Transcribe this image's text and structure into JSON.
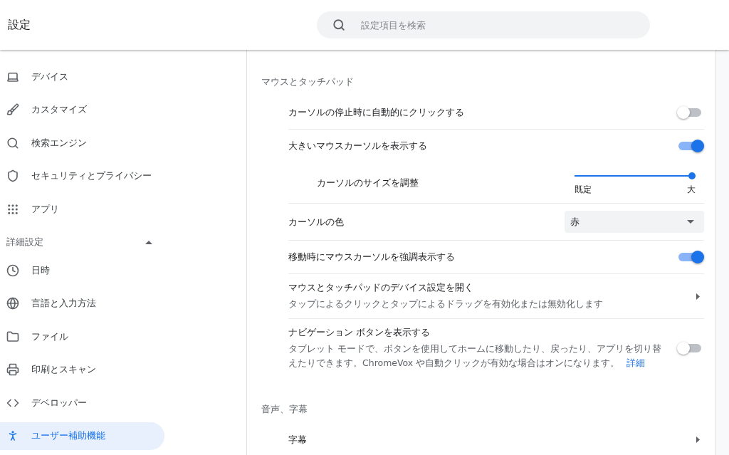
{
  "header": {
    "title": "設定",
    "search": {
      "placeholder": "設定項目を検索"
    }
  },
  "sidebar": {
    "items": [
      {
        "label": "デバイス",
        "selected": false
      },
      {
        "label": "カスタマイズ",
        "selected": false
      },
      {
        "label": "検索エンジン",
        "selected": false
      },
      {
        "label": "セキュリティとプライバシー",
        "selected": false
      },
      {
        "label": "アプリ",
        "selected": false
      }
    ],
    "advanced": {
      "label": "詳細設定",
      "expanded": true,
      "items": [
        {
          "label": "日時",
          "selected": false
        },
        {
          "label": "言語と入力方法",
          "selected": false
        },
        {
          "label": "ファイル",
          "selected": false
        },
        {
          "label": "印刷とスキャン",
          "selected": false
        },
        {
          "label": "デベロッパー",
          "selected": false
        },
        {
          "label": "ユーザー補助機能",
          "selected": true
        }
      ]
    }
  },
  "sections": [
    {
      "title": "マウスとタッチパッド",
      "rows": [
        {
          "kind": "toggle",
          "label": "カーソルの停止時に自動的にクリックする",
          "on": false
        },
        {
          "kind": "toggle",
          "label": "大きいマウスカーソルを表示する",
          "on": true
        },
        {
          "kind": "slider",
          "label": "カーソルのサイズを調整",
          "level": 1,
          "min_label": "既定",
          "max_label": "大"
        },
        {
          "kind": "select",
          "label": "カーソルの色",
          "value": "赤"
        },
        {
          "kind": "toggle",
          "label": "移動時にマウスカーソルを強調表示する",
          "on": true
        },
        {
          "kind": "link",
          "label": "マウスとタッチパッドのデバイス設定を開く",
          "description": "タップによるクリックとタップによるドラッグを有効化または無効化します"
        },
        {
          "kind": "toggle",
          "label": "ナビゲーション ボタンを表示する",
          "description": "タブレット モードで、ボタンを使用してホームに移動したり、戻ったり、アプリを切り替えたりできます。ChromeVox や自動クリックが有効な場合はオンになります。",
          "link": "詳細",
          "on": false
        }
      ]
    },
    {
      "title": "音声、字幕",
      "rows": [
        {
          "kind": "link",
          "label": "字幕"
        }
      ]
    }
  ]
}
